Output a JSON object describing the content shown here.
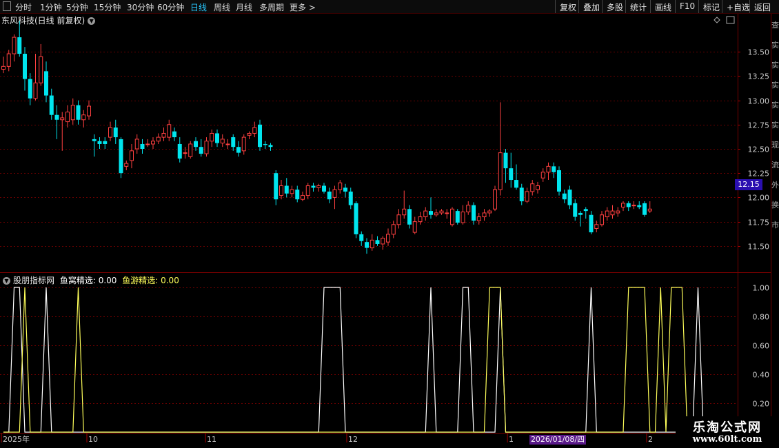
{
  "toolbar": {
    "periods": [
      "分时",
      "1分钟",
      "5分钟",
      "15分钟",
      "30分钟",
      "60分钟",
      "日线",
      "周线",
      "月线",
      "多周期",
      "更多 >"
    ],
    "active": "日线",
    "right_buttons": [
      "复权",
      "叠加",
      "多股",
      "统计",
      "画线",
      "F10",
      "标记",
      "+自选",
      "返回"
    ]
  },
  "stock": {
    "title": "东风科技(日线 前复权)"
  },
  "indicator": {
    "name": "股朋指标网",
    "f1_label": "鱼窝精选: 0.00",
    "f2_label": "鱼游精选: 0.00"
  },
  "colors": {
    "up": "#ff4040",
    "down": "#00e5ee",
    "line1": "#ffffff",
    "line2": "#ffff5a",
    "grid": "#6a0000"
  },
  "price_axis": [
    "13.50",
    "13.25",
    "13.00",
    "12.75",
    "12.50",
    "12.25",
    "12.00",
    "11.75",
    "11.50"
  ],
  "current_price": "12.15",
  "ind_axis": [
    "1.00",
    "0.80",
    "0.60",
    "0.40",
    "0.20"
  ],
  "x_axis": [
    "2025年",
    "10",
    "11",
    "12",
    "1",
    "2"
  ],
  "cursor_date": "2026/01/08/四",
  "watermark": {
    "line1": "乐淘公式网",
    "line2": "www.60lt.com"
  },
  "side_chars": [
    "查",
    "实",
    "实",
    "实",
    "实",
    "实",
    "现",
    "流",
    "外",
    "换",
    "市"
  ],
  "chart_data": {
    "type": "candlestick",
    "x_count": 136,
    "price_ylim": [
      11.25,
      13.75
    ],
    "candles": [
      [
        13.32,
        13.35,
        13.28,
        13.45
      ],
      [
        13.35,
        13.48,
        13.3,
        13.52
      ],
      [
        13.48,
        13.65,
        13.4,
        13.68
      ],
      [
        13.65,
        13.48,
        13.45,
        13.82
      ],
      [
        13.48,
        13.22,
        13.1,
        13.55
      ],
      [
        13.22,
        13.02,
        12.95,
        13.28
      ],
      [
        13.02,
        13.18,
        13.0,
        13.48
      ],
      [
        13.18,
        13.45,
        13.15,
        13.58
      ],
      [
        13.3,
        13.05,
        12.98,
        13.4
      ],
      [
        13.05,
        12.85,
        12.8,
        13.12
      ],
      [
        12.85,
        12.8,
        12.6,
        12.95
      ],
      [
        12.8,
        12.82,
        12.48,
        12.88
      ],
      [
        12.78,
        12.88,
        12.72,
        12.95
      ],
      [
        12.8,
        12.95,
        12.75,
        13.02
      ],
      [
        12.95,
        12.8,
        12.75,
        13.0
      ],
      [
        12.8,
        12.85,
        12.72,
        12.9
      ],
      [
        12.84,
        12.94,
        12.8,
        13.0
      ],
      [
        12.6,
        12.58,
        12.42,
        12.65
      ],
      [
        12.58,
        12.55,
        12.5,
        12.62
      ],
      [
        12.58,
        12.55,
        12.5,
        12.62
      ],
      [
        12.62,
        12.72,
        12.58,
        12.78
      ],
      [
        12.72,
        12.62,
        12.55,
        12.8
      ],
      [
        12.6,
        12.25,
        12.2,
        12.62
      ],
      [
        12.32,
        12.35,
        12.28,
        12.38
      ],
      [
        12.38,
        12.48,
        12.3,
        12.55
      ],
      [
        12.5,
        12.6,
        12.45,
        12.65
      ],
      [
        12.55,
        12.5,
        12.45,
        12.6
      ],
      [
        12.55,
        12.55,
        12.52,
        12.6
      ],
      [
        12.55,
        12.58,
        12.5,
        12.62
      ],
      [
        12.58,
        12.62,
        12.55,
        12.66
      ],
      [
        12.62,
        12.66,
        12.58,
        12.72
      ],
      [
        12.62,
        12.75,
        12.58,
        12.8
      ],
      [
        12.68,
        12.62,
        12.58,
        12.72
      ],
      [
        12.55,
        12.4,
        12.36,
        12.62
      ],
      [
        12.46,
        12.46,
        12.4,
        12.52
      ],
      [
        12.42,
        12.55,
        12.4,
        12.58
      ],
      [
        12.58,
        12.52,
        12.48,
        12.62
      ],
      [
        12.52,
        12.45,
        12.42,
        12.6
      ],
      [
        12.45,
        12.58,
        12.42,
        12.62
      ],
      [
        12.58,
        12.66,
        12.52,
        12.7
      ],
      [
        12.66,
        12.56,
        12.52,
        12.7
      ],
      [
        12.56,
        12.6,
        12.52,
        12.65
      ],
      [
        12.55,
        12.55,
        12.5,
        12.6
      ],
      [
        12.62,
        12.52,
        12.48,
        12.65
      ],
      [
        12.52,
        12.46,
        12.42,
        12.58
      ],
      [
        12.48,
        12.62,
        12.44,
        12.65
      ],
      [
        12.64,
        12.66,
        12.6,
        12.68
      ],
      [
        12.66,
        12.72,
        12.62,
        12.78
      ],
      [
        12.75,
        12.52,
        12.48,
        12.8
      ],
      [
        12.55,
        12.54,
        12.5,
        12.58
      ],
      [
        12.54,
        12.52,
        12.48,
        12.56
      ],
      [
        12.25,
        11.98,
        11.92,
        12.28
      ],
      [
        12.02,
        12.12,
        11.98,
        12.18
      ],
      [
        12.12,
        12.04,
        12.0,
        12.2
      ],
      [
        12.04,
        12.08,
        12.0,
        12.12
      ],
      [
        12.08,
        11.98,
        11.95,
        12.12
      ],
      [
        11.98,
        12.02,
        11.96,
        12.06
      ],
      [
        12.02,
        12.12,
        11.98,
        12.15
      ],
      [
        12.12,
        12.1,
        12.06,
        12.15
      ],
      [
        12.1,
        12.12,
        12.06,
        12.14
      ],
      [
        12.12,
        12.06,
        12.04,
        12.15
      ],
      [
        12.06,
        11.98,
        11.94,
        12.1
      ],
      [
        12.0,
        12.08,
        11.88,
        12.12
      ],
      [
        12.08,
        12.15,
        12.04,
        12.18
      ],
      [
        12.1,
        12.06,
        12.0,
        12.14
      ],
      [
        12.06,
        11.92,
        11.88,
        12.1
      ],
      [
        11.94,
        11.62,
        11.58,
        11.96
      ],
      [
        11.62,
        11.55,
        11.5,
        11.65
      ],
      [
        11.54,
        11.48,
        11.42,
        11.58
      ],
      [
        11.48,
        11.56,
        11.45,
        11.62
      ],
      [
        11.56,
        11.52,
        11.5,
        11.6
      ],
      [
        11.52,
        11.58,
        11.46,
        11.6
      ],
      [
        11.54,
        11.62,
        11.5,
        11.68
      ],
      [
        11.62,
        11.72,
        11.58,
        11.76
      ],
      [
        11.72,
        11.82,
        11.68,
        11.88
      ],
      [
        11.82,
        11.88,
        11.78,
        12.07
      ],
      [
        11.88,
        11.72,
        11.68,
        11.92
      ],
      [
        11.64,
        11.75,
        11.62,
        11.8
      ],
      [
        11.75,
        11.8,
        11.72,
        11.85
      ],
      [
        11.8,
        11.86,
        11.76,
        11.9
      ],
      [
        11.86,
        11.82,
        11.78,
        12.0
      ],
      [
        11.82,
        11.84,
        11.8,
        11.88
      ],
      [
        11.84,
        11.86,
        11.82,
        11.88
      ],
      [
        11.84,
        11.84,
        11.78,
        11.88
      ],
      [
        11.72,
        11.88,
        11.7,
        11.9
      ],
      [
        11.86,
        11.74,
        11.72,
        11.88
      ],
      [
        11.74,
        11.85,
        11.72,
        11.92
      ],
      [
        11.85,
        11.92,
        11.82,
        11.96
      ],
      [
        11.92,
        11.76,
        11.72,
        11.95
      ],
      [
        11.76,
        11.8,
        11.72,
        11.84
      ],
      [
        11.8,
        11.84,
        11.76,
        11.88
      ],
      [
        11.84,
        11.86,
        11.8,
        11.88
      ],
      [
        11.88,
        12.08,
        11.86,
        12.12
      ],
      [
        12.08,
        12.46,
        12.02,
        12.98
      ],
      [
        12.46,
        12.3,
        12.15,
        12.5
      ],
      [
        12.3,
        12.18,
        12.1,
        12.46
      ],
      [
        12.18,
        12.1,
        12.08,
        12.34
      ],
      [
        12.1,
        11.96,
        11.92,
        12.14
      ],
      [
        11.96,
        12.06,
        11.94,
        12.1
      ],
      [
        12.06,
        12.14,
        12.02,
        12.18
      ],
      [
        12.08,
        12.12,
        12.04,
        12.16
      ],
      [
        12.2,
        12.26,
        12.16,
        12.3
      ],
      [
        12.26,
        12.32,
        12.18,
        12.36
      ],
      [
        12.32,
        12.26,
        12.2,
        12.36
      ],
      [
        12.28,
        12.06,
        12.02,
        12.32
      ],
      [
        12.04,
        11.98,
        11.94,
        12.08
      ],
      [
        12.08,
        11.92,
        11.88,
        12.12
      ],
      [
        11.94,
        11.8,
        11.76,
        11.98
      ],
      [
        11.84,
        11.82,
        11.7,
        11.86
      ],
      [
        11.88,
        11.86,
        11.78,
        11.9
      ],
      [
        11.82,
        11.64,
        11.62,
        11.86
      ],
      [
        11.68,
        11.72,
        11.64,
        11.76
      ],
      [
        11.72,
        11.82,
        11.7,
        11.86
      ],
      [
        11.8,
        11.86,
        11.76,
        11.9
      ],
      [
        11.82,
        11.86,
        11.78,
        11.92
      ],
      [
        11.84,
        11.86,
        11.8,
        11.9
      ],
      [
        11.9,
        11.94,
        11.86,
        11.96
      ],
      [
        11.94,
        11.9,
        11.86,
        11.96
      ],
      [
        11.92,
        11.92,
        11.88,
        11.96
      ],
      [
        11.92,
        11.9,
        11.88,
        11.96
      ],
      [
        11.94,
        11.82,
        11.8,
        11.96
      ],
      [
        11.86,
        11.88,
        11.84,
        11.96
      ]
    ],
    "series": [
      {
        "name": "鱼窝精选",
        "values": [
          0,
          0,
          1,
          1,
          0,
          0,
          0,
          0,
          1,
          0,
          0,
          0,
          0,
          0,
          0,
          0,
          0,
          0,
          0,
          0,
          0,
          0,
          0,
          0,
          0,
          0,
          0,
          0,
          0,
          0,
          0,
          0,
          0,
          0,
          0,
          0,
          0,
          0,
          0,
          0,
          0,
          0,
          0,
          0,
          0,
          0,
          0,
          0,
          0,
          0,
          0,
          0,
          0,
          0,
          0,
          0,
          0,
          0,
          0,
          0,
          1,
          1,
          1,
          1,
          0,
          0,
          0,
          0,
          0,
          0,
          0,
          0,
          0,
          0,
          0,
          0,
          0,
          0,
          0,
          0,
          1,
          0,
          0,
          0,
          0,
          0,
          1,
          1,
          0,
          0,
          0,
          0,
          0,
          1,
          0,
          0,
          0,
          0,
          0,
          0,
          0,
          0,
          0,
          0,
          0,
          0,
          0,
          0,
          0,
          0,
          1,
          0,
          0,
          0,
          0,
          0,
          0,
          0,
          0,
          0,
          0,
          0,
          0,
          0,
          0,
          0,
          0,
          0,
          0,
          0,
          1,
          0,
          0,
          0,
          0,
          0
        ]
      },
      {
        "name": "鱼游精选",
        "values": [
          0,
          0,
          0,
          0,
          1,
          0,
          0,
          0,
          0,
          0,
          0,
          0,
          0,
          0,
          1,
          0,
          0,
          0,
          0,
          0,
          0,
          0,
          0,
          0,
          0,
          0,
          0,
          0,
          0,
          0,
          0,
          0,
          0,
          0,
          0,
          0,
          0,
          0,
          0,
          0,
          0,
          0,
          0,
          0,
          0,
          0,
          0,
          0,
          0,
          0,
          0,
          0,
          0,
          0,
          0,
          0,
          0,
          0,
          0,
          0,
          0,
          0,
          0,
          0,
          0,
          0,
          0,
          0,
          0,
          0,
          0,
          0,
          0,
          0,
          0,
          0,
          0,
          0,
          0,
          0,
          0,
          0,
          0,
          0,
          0,
          0,
          0,
          0,
          0,
          0,
          0,
          1,
          1,
          1,
          0,
          0,
          0,
          0,
          0,
          0,
          0,
          0,
          0,
          0,
          0,
          0,
          0,
          0,
          0,
          0,
          0,
          0,
          0,
          0,
          0,
          0,
          0,
          1,
          1,
          1,
          1,
          0,
          0,
          1,
          0,
          1,
          1,
          1,
          0,
          0,
          0,
          0,
          0,
          0,
          0,
          0
        ]
      }
    ]
  }
}
